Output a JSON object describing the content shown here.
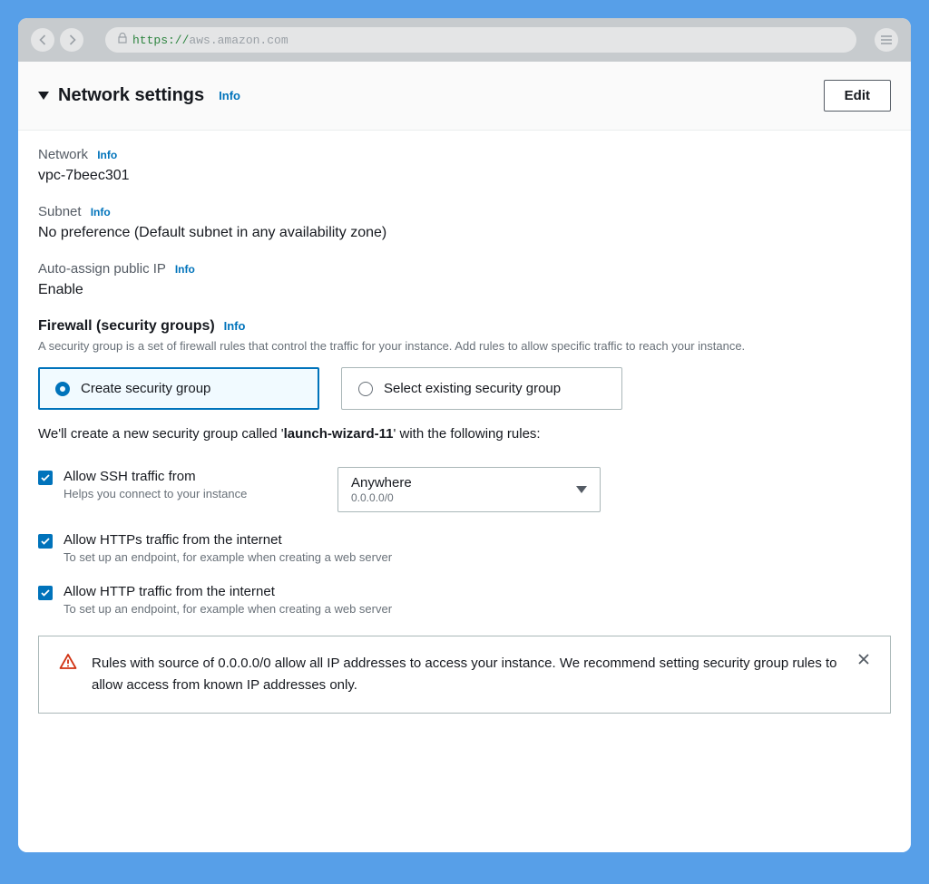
{
  "browser": {
    "url_scheme": "https://",
    "url_host": "aws.amazon.com"
  },
  "header": {
    "title": "Network settings",
    "info": "Info",
    "edit": "Edit"
  },
  "network": {
    "label": "Network",
    "info": "Info",
    "value": "vpc-7beec301"
  },
  "subnet": {
    "label": "Subnet",
    "info": "Info",
    "value": "No preference (Default subnet in any availability zone)"
  },
  "auto_ip": {
    "label": "Auto-assign public IP",
    "info": "Info",
    "value": "Enable"
  },
  "firewall": {
    "title": "Firewall (security groups)",
    "info": "Info",
    "desc": "A security group is a set of firewall rules that control the traffic for your instance. Add rules to allow specific traffic to reach your instance.",
    "option_create": "Create security group",
    "option_existing": "Select existing security group",
    "note_prefix": "We'll create a new security group called '",
    "note_name": "launch-wizard-11",
    "note_suffix": "' with the following rules:"
  },
  "rules": {
    "ssh": {
      "title": "Allow SSH traffic from",
      "desc": "Helps you connect to your instance",
      "select_main": "Anywhere",
      "select_sub": "0.0.0.0/0"
    },
    "https": {
      "title": "Allow HTTPs traffic from the internet",
      "desc": "To set up an endpoint, for example when creating a web server"
    },
    "http": {
      "title": "Allow HTTP traffic from the internet",
      "desc": "To set up an endpoint, for example when creating a web server"
    }
  },
  "alert": {
    "text": "Rules with source of 0.0.0.0/0 allow all IP addresses to access your instance. We recommend setting security group rules to allow access from known IP addresses only."
  }
}
